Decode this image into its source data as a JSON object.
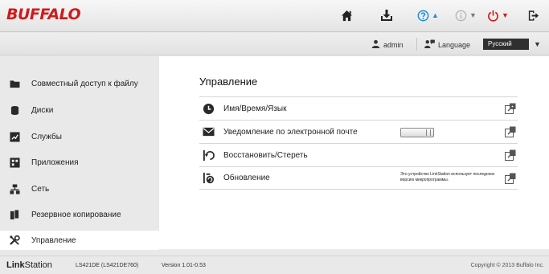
{
  "header": {
    "logo": "BUFFALO",
    "buttons": [
      {
        "name": "home",
        "icon": "home-icon"
      },
      {
        "name": "download",
        "icon": "download-icon"
      },
      {
        "name": "help",
        "icon": "help-icon",
        "color": "#1a8fe0"
      },
      {
        "name": "info",
        "icon": "info-icon",
        "color": "#b5b5b5"
      },
      {
        "name": "power",
        "icon": "power-icon",
        "color": "#d11a1a"
      },
      {
        "name": "logout",
        "icon": "logout-icon"
      }
    ]
  },
  "subheader": {
    "user": "admin",
    "language_label": "Language",
    "language_value": "Русский"
  },
  "sidebar": {
    "items": [
      {
        "label": "Совместный доступ к файлу",
        "icon": "folder-icon"
      },
      {
        "label": "Диски",
        "icon": "disk-icon"
      },
      {
        "label": "Службы",
        "icon": "services-icon"
      },
      {
        "label": "Приложения",
        "icon": "applications-icon"
      },
      {
        "label": "Сеть",
        "icon": "network-icon"
      },
      {
        "label": "Резервное копирование",
        "icon": "backup-icon"
      },
      {
        "label": "Управление",
        "icon": "tools-icon",
        "active": true
      }
    ]
  },
  "main": {
    "title": "Управление",
    "rows": [
      {
        "label": "Имя/Время/Язык",
        "icon": "clock-icon"
      },
      {
        "label": "Уведомление по электронной почте",
        "icon": "mail-icon",
        "toggle": "off"
      },
      {
        "label": "Восстановить/Стереть",
        "icon": "restore-icon"
      },
      {
        "label": "Обновление",
        "icon": "update-icon",
        "note": "Это устройство LinkStation использует последнюю версию микропрограммы."
      }
    ]
  },
  "footer": {
    "brand_bold": "Link",
    "brand_rest": "Station",
    "model": "LS421DE (LS421DE760)",
    "version": "Version 1.01-0.53",
    "copyright": "Copyright © 2013 Buffalo Inc."
  },
  "colors": {
    "brand": "#d11a1a",
    "help": "#1a8fe0",
    "sidebar_bg": "#e9e9e9",
    "main_bg": "#ffffff"
  }
}
